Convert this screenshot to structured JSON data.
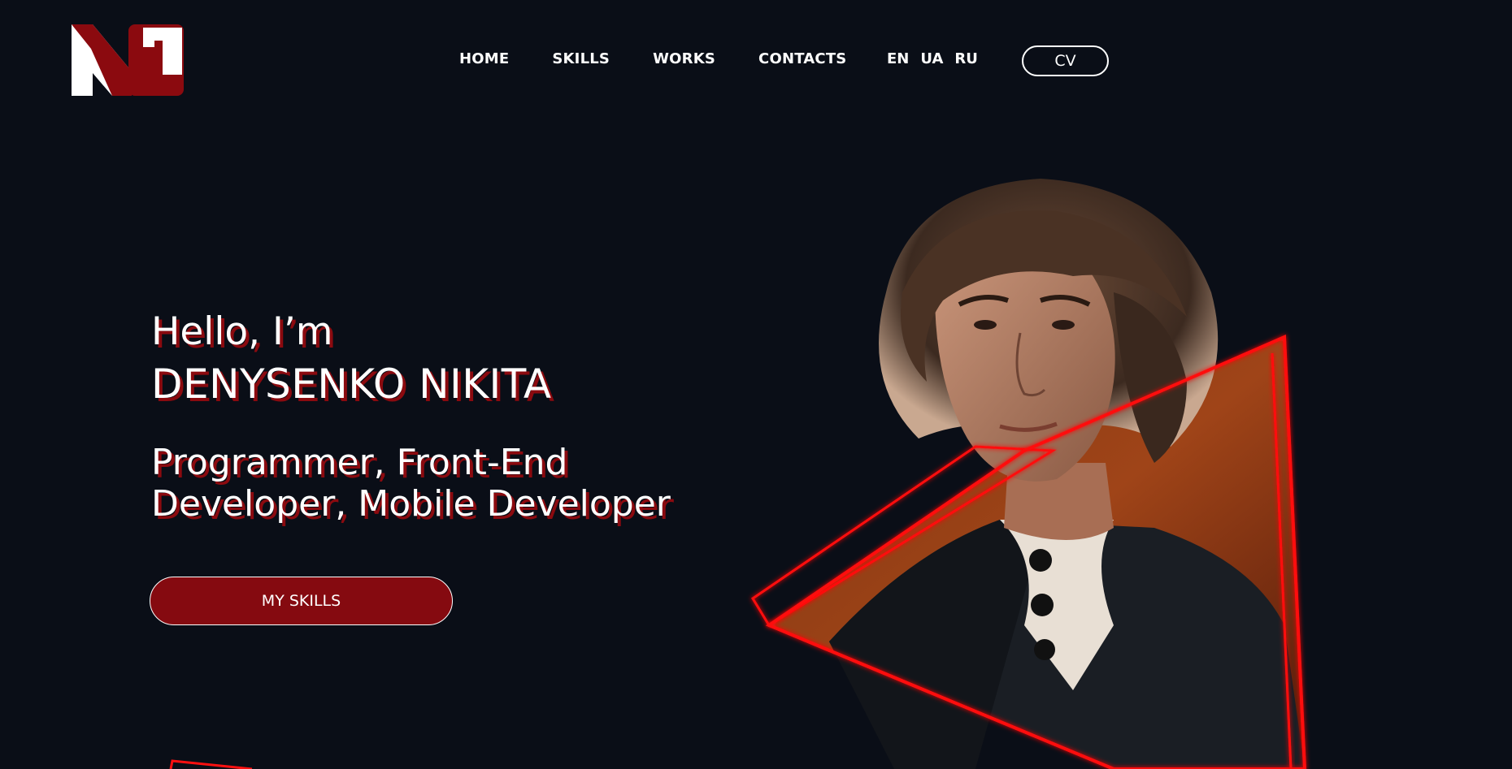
{
  "header": {
    "nav": [
      {
        "label": "HOME"
      },
      {
        "label": "SKILLS"
      },
      {
        "label": "WORKS"
      },
      {
        "label": "CONTACTS"
      }
    ],
    "languages": [
      {
        "label": "EN"
      },
      {
        "label": "UA"
      },
      {
        "label": "RU"
      }
    ],
    "cv_label": "CV"
  },
  "hero": {
    "greeting": "Hello, I’m",
    "name": "DENYSENKO NIKITA",
    "role": "Programmer, Front-End Developer, Mobile Developer",
    "cta_label": "MY SKILLS"
  },
  "colors": {
    "background": "#0a0e17",
    "accent": "#850a10",
    "text_shadow": "#8b0a0f",
    "triangle_outline": "#ff1010"
  }
}
